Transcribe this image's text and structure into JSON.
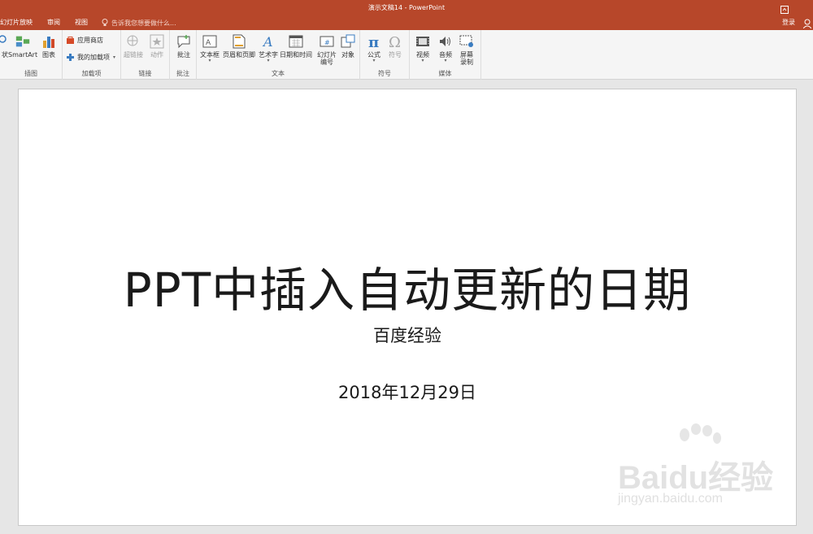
{
  "window": {
    "title": "演示文稿14 - PowerPoint",
    "login": "登录"
  },
  "menu": {
    "tabs": [
      "幻灯片放映",
      "审阅",
      "视图"
    ],
    "tell_me": "告诉我您想要做什么..."
  },
  "ribbon": {
    "groups": {
      "illustrations": {
        "label": "插图",
        "smartart": "SmartArt",
        "chart": "图表",
        "partial": "状"
      },
      "addins": {
        "label": "加载项",
        "store": "应用商店",
        "my_addins": "我的加载项"
      },
      "links": {
        "label": "链接",
        "hyperlink": "超链接",
        "action": "动作"
      },
      "comments": {
        "label": "批注",
        "comment": "批注"
      },
      "text": {
        "label": "文本",
        "textbox": "文本框",
        "header_footer": "页眉和页脚",
        "wordart": "艺术字",
        "datetime": "日期和时间",
        "slide_number_1": "幻灯片",
        "slide_number_2": "编号",
        "object": "对象"
      },
      "symbols": {
        "label": "符号",
        "equation": "公式",
        "symbol": "符号"
      },
      "media": {
        "label": "媒体",
        "video": "视频",
        "audio": "音频",
        "screen_rec_1": "屏幕",
        "screen_rec_2": "录制"
      }
    }
  },
  "slide": {
    "title": "PPT中插入自动更新的日期",
    "subtitle": "百度经验",
    "date": "2018年12月29日"
  },
  "watermark": {
    "brand": "Baidu经验",
    "url": "jingyan.baidu.com"
  },
  "colors": {
    "accent": "#b7472a",
    "ribbon_bg": "#f5f5f5",
    "workspace_bg": "#e6e6e6"
  }
}
